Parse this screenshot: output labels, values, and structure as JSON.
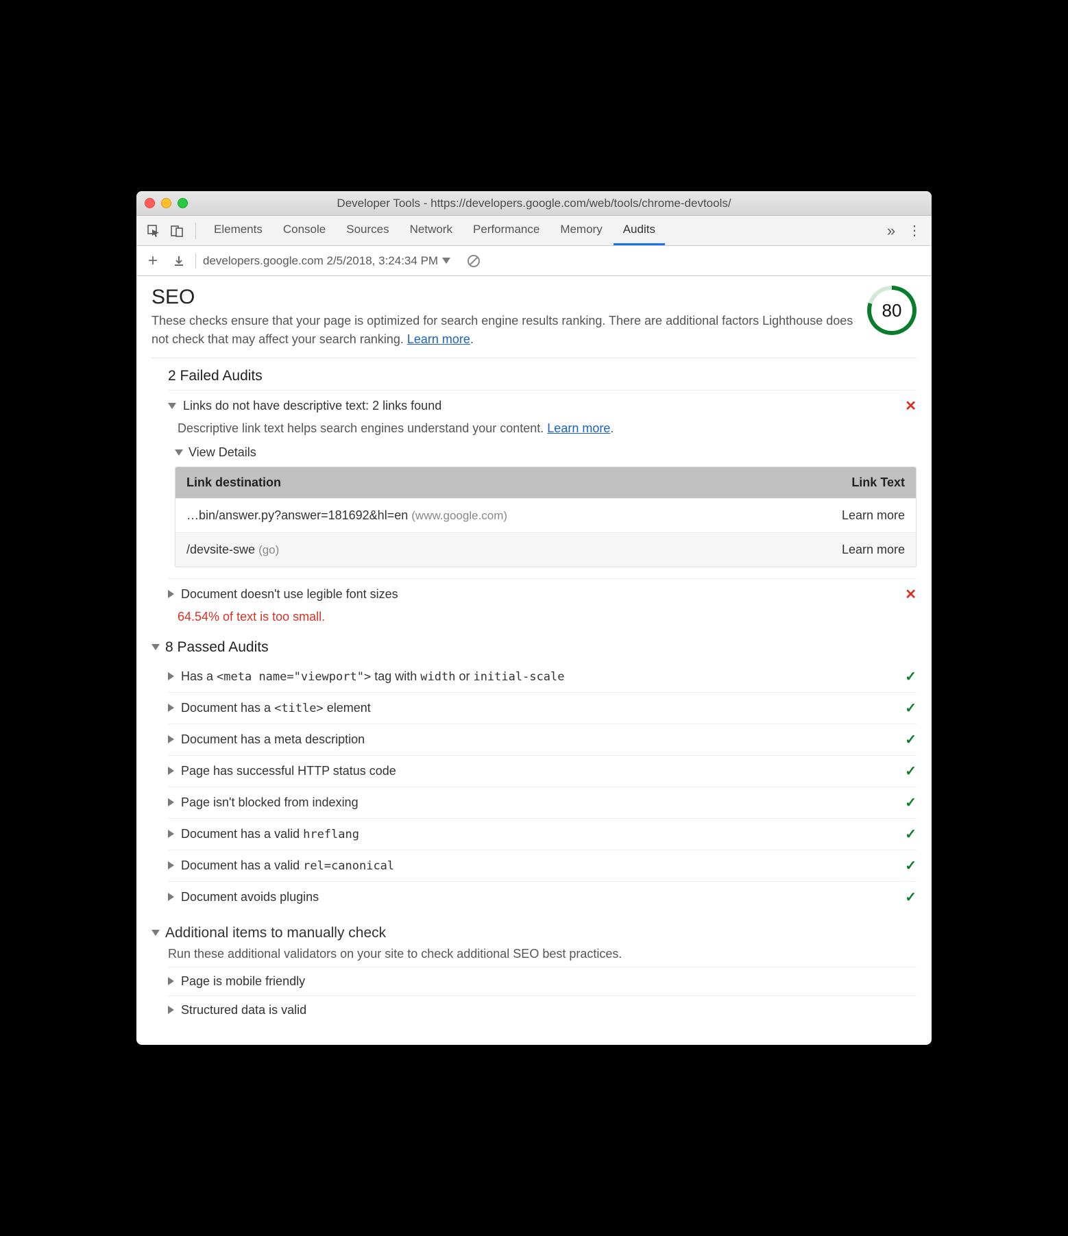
{
  "window": {
    "title": "Developer Tools - https://developers.google.com/web/tools/chrome-devtools/"
  },
  "tabs": {
    "items": [
      "Elements",
      "Console",
      "Sources",
      "Network",
      "Performance",
      "Memory",
      "Audits"
    ],
    "active": "Audits"
  },
  "subbar": {
    "report_label": "developers.google.com 2/5/2018, 3:24:34 PM"
  },
  "seo": {
    "heading": "SEO",
    "description": "These checks ensure that your page is optimized for search engine results ranking. There are additional factors Lighthouse does not check that may affect your search ranking. ",
    "learn_more": "Learn more",
    "score": "80"
  },
  "failed": {
    "title": "2 Failed Audits",
    "items": [
      {
        "label": "Links do not have descriptive text: 2 links found",
        "detail": "Descriptive link text helps search engines understand your content. ",
        "learn_more": "Learn more",
        "expanded": true,
        "view_details": "View Details",
        "table": {
          "headers": {
            "c1": "Link destination",
            "c2": "Link Text"
          },
          "rows": [
            {
              "dest": "…bin/answer.py?answer=181692&hl=en",
              "host": "(www.google.com)",
              "text": "Learn more"
            },
            {
              "dest": "/devsite-swe",
              "host": "(go)",
              "text": "Learn more"
            }
          ]
        }
      },
      {
        "label": "Document doesn't use legible font sizes",
        "warn": "64.54% of text is too small.",
        "expanded": false
      }
    ]
  },
  "passed": {
    "title": "8 Passed Audits",
    "items": [
      {
        "pre": "Has a ",
        "code": "<meta name=\"viewport\">",
        "mid": " tag with ",
        "code2": "width",
        "mid2": " or ",
        "code3": "initial-scale"
      },
      {
        "pre": "Document has a ",
        "code": "<title>",
        "mid": " element"
      },
      {
        "pre": "Document has a meta description"
      },
      {
        "pre": "Page has successful HTTP status code"
      },
      {
        "pre": "Page isn't blocked from indexing"
      },
      {
        "pre": "Document has a valid ",
        "code": "hreflang"
      },
      {
        "pre": "Document has a valid ",
        "code": "rel=canonical"
      },
      {
        "pre": "Document avoids plugins"
      }
    ]
  },
  "manual": {
    "title": "Additional items to manually check",
    "desc": "Run these additional validators on your site to check additional SEO best practices.",
    "items": [
      {
        "label": "Page is mobile friendly"
      },
      {
        "label": "Structured data is valid"
      }
    ]
  }
}
